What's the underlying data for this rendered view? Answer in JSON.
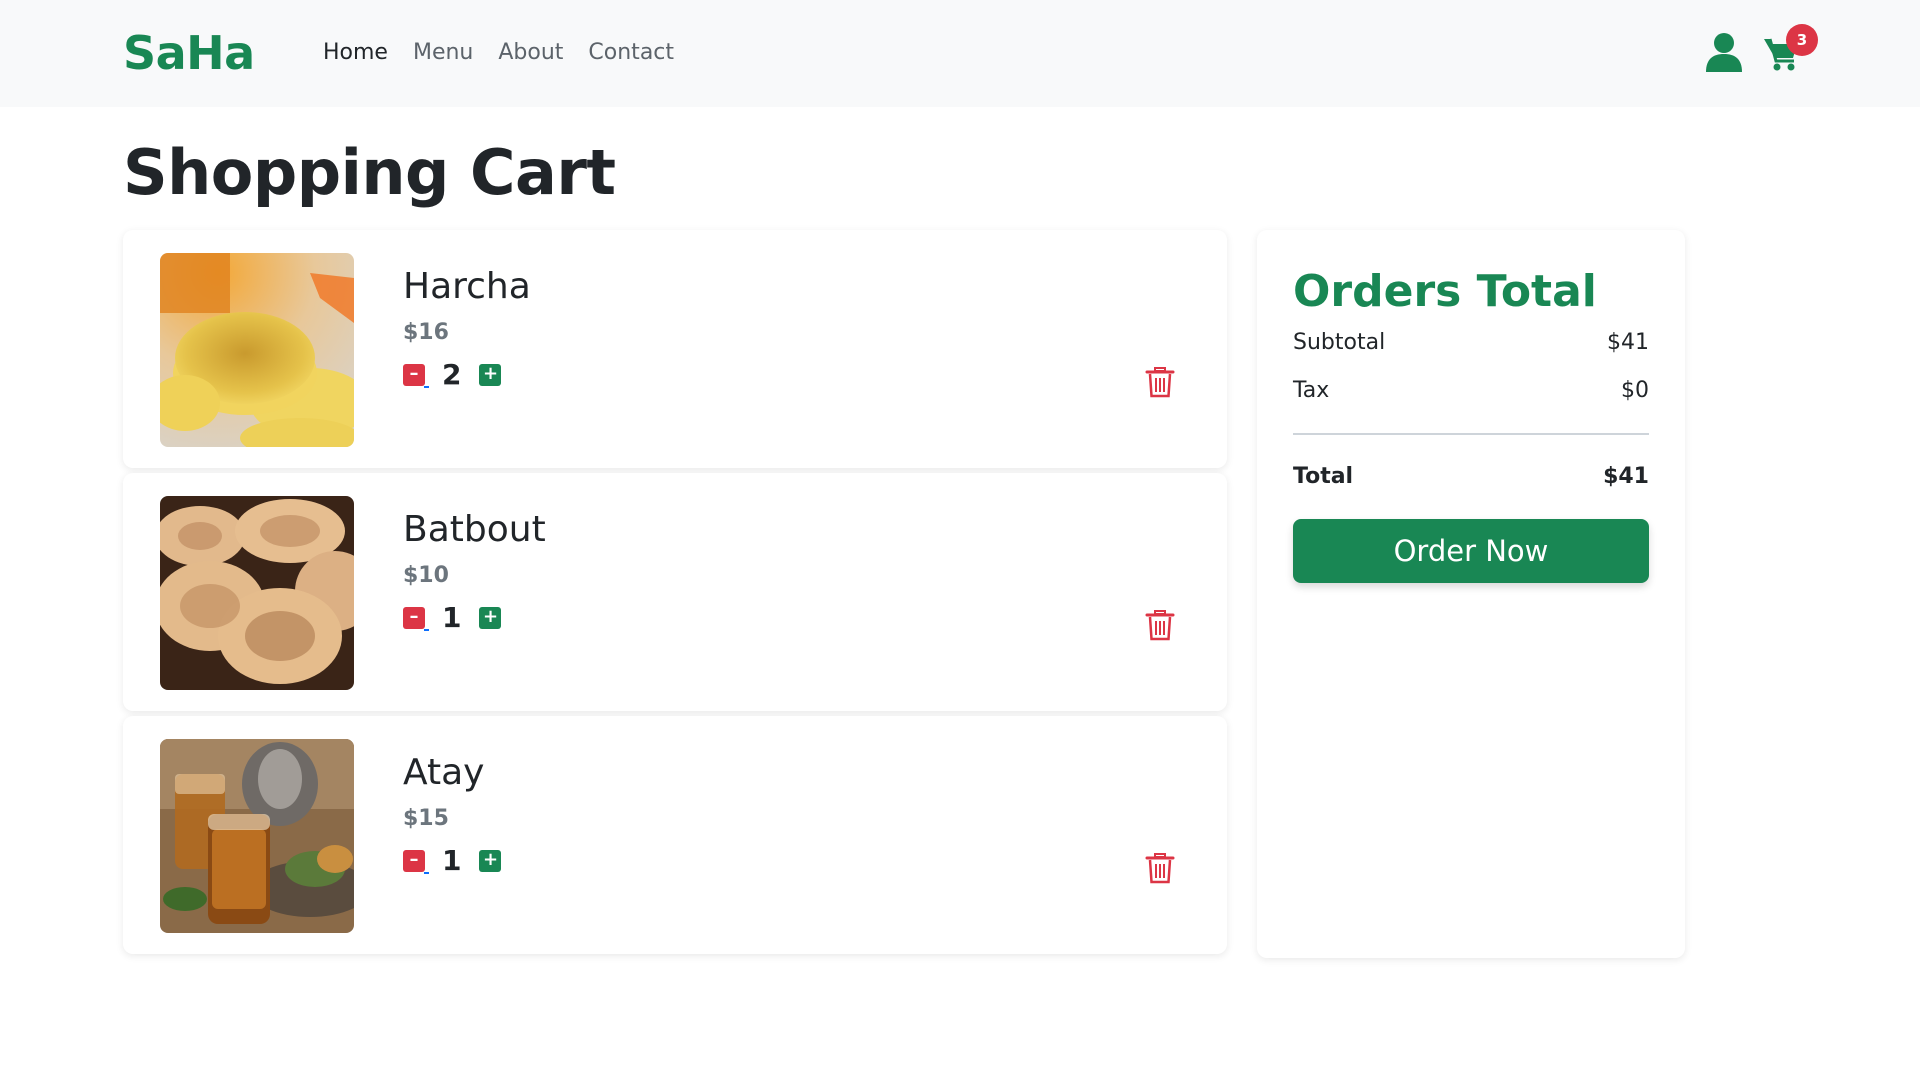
{
  "nav": {
    "brand": "SaHa",
    "links": [
      {
        "label": "Home",
        "active": true
      },
      {
        "label": "Menu",
        "active": false
      },
      {
        "label": "About",
        "active": false
      },
      {
        "label": "Contact",
        "active": false
      }
    ],
    "cart_count": "3",
    "user_icon": "user-icon",
    "cart_icon": "shopping-cart-icon"
  },
  "page": {
    "title": "Shopping Cart"
  },
  "cart": {
    "items": [
      {
        "name": "Harcha",
        "price": "$16",
        "quantity": "2",
        "image": "harcha-photo"
      },
      {
        "name": "Batbout",
        "price": "$10",
        "quantity": "1",
        "image": "batbout-photo"
      },
      {
        "name": "Atay",
        "price": "$15",
        "quantity": "1",
        "image": "atay-photo"
      }
    ],
    "minus_label": "–",
    "plus_label": "+",
    "delete_icon": "trash-icon"
  },
  "summary": {
    "title": "Orders Total",
    "subtotal_label": "Subtotal",
    "subtotal_value": "$41",
    "tax_label": "Tax",
    "tax_value": "$0",
    "total_label": "Total",
    "total_value": "$41",
    "order_button": "Order Now"
  },
  "colors": {
    "brand": "#198754",
    "danger": "#dc3545",
    "muted": "#6c757d",
    "navbar_bg": "#f8f9fa"
  }
}
